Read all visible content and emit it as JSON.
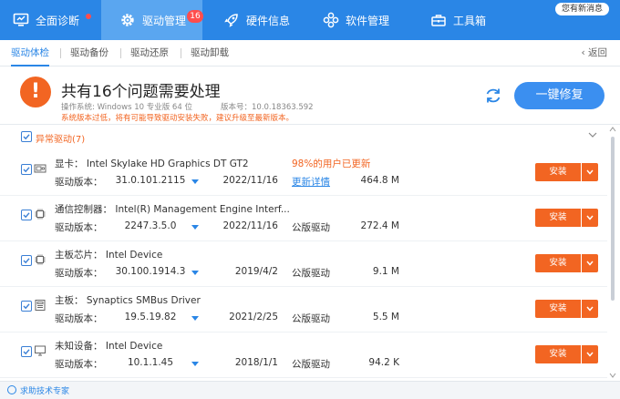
{
  "nav": {
    "tabs": [
      {
        "label": "全面诊断",
        "icon": "monitor-icon"
      },
      {
        "label": "驱动管理",
        "icon": "gear-icon",
        "badge": "16"
      },
      {
        "label": "硬件信息",
        "icon": "rocket-icon"
      },
      {
        "label": "软件管理",
        "icon": "apps-icon"
      },
      {
        "label": "工具箱",
        "icon": "toolbox-icon"
      }
    ],
    "message": "您有新消息"
  },
  "subnav": {
    "tabs": [
      "驱动体检",
      "驱动备份",
      "驱动还原",
      "驱动卸载"
    ],
    "back": "返回"
  },
  "summary": {
    "title": "共有16个问题需要处理",
    "os": "操作系统: Windows 10 专业版 64 位",
    "version": "版本号：10.0.18363.592",
    "note": "系统版本过低，将有可能导致驱动安装失败，建议升级至最新版本。",
    "fix_button": "一键修复"
  },
  "section": {
    "title": "异常驱动(7)"
  },
  "devices": [
    {
      "category": "显卡：",
      "name": "Intel Skylake HD Graphics DT GT2",
      "version_label": "驱动版本：",
      "version": "31.0.101.2115",
      "date": "2022/11/16",
      "extra": "98%的用户已更新",
      "status": "更新详情",
      "status_link": true,
      "size": "464.8 M",
      "install": "安装",
      "icon": "display-card-icon"
    },
    {
      "category": "通信控制器：",
      "name": "Intel(R) Management Engine Interf...",
      "version_label": "驱动版本：",
      "version": "2247.3.5.0",
      "date": "2022/11/16",
      "extra": "",
      "status": "公版驱动",
      "status_link": false,
      "size": "272.4 M",
      "install": "安装",
      "icon": "chip-icon"
    },
    {
      "category": "主板芯片：",
      "name": "Intel Device",
      "version_label": "驱动版本：",
      "version": "30.100.1914.3",
      "date": "2019/4/2",
      "extra": "",
      "status": "公版驱动",
      "status_link": false,
      "size": "9.1 M",
      "install": "安装",
      "icon": "chip-icon"
    },
    {
      "category": "主板：",
      "name": "Synaptics SMBus Driver",
      "version_label": "驱动版本：",
      "version": "19.5.19.82",
      "date": "2021/2/25",
      "extra": "",
      "status": "公版驱动",
      "status_link": false,
      "size": "5.5 M",
      "install": "安装",
      "icon": "motherboard-icon"
    },
    {
      "category": "未知设备：",
      "name": "Intel Device",
      "version_label": "驱动版本：",
      "version": "10.1.1.45",
      "date": "2018/1/1",
      "extra": "",
      "status": "公版驱动",
      "status_link": false,
      "size": "94.2 K",
      "install": "安装",
      "icon": "monitor-device-icon"
    }
  ],
  "footer": {
    "expert": "求助技术专家"
  },
  "colors": {
    "primary": "#2a86e6",
    "accent": "#f26522"
  }
}
